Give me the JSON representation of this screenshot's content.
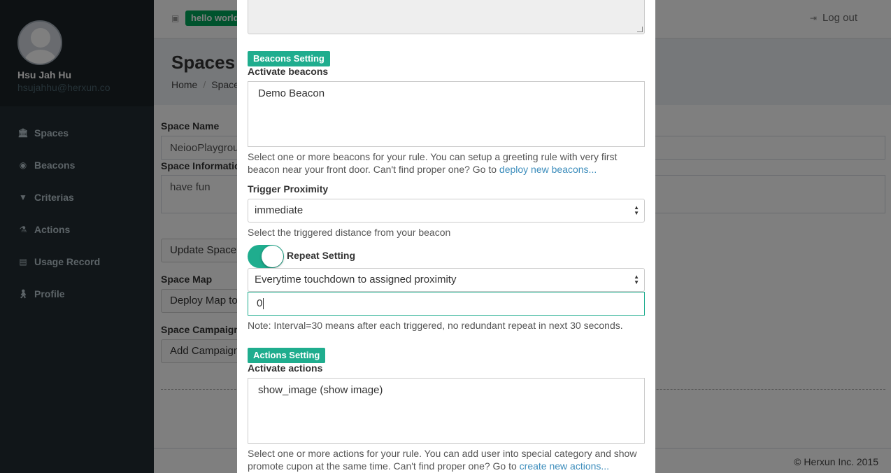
{
  "sidebar": {
    "user_name": "Hsu Jah Hu",
    "user_email": "hsujahhu@herxun.co",
    "items": [
      {
        "label": "Spaces",
        "icon": "bank-icon"
      },
      {
        "label": "Beacons",
        "icon": "dot-circle-icon"
      },
      {
        "label": "Criterias",
        "icon": "filter-icon"
      },
      {
        "label": "Actions",
        "icon": "flask-icon"
      },
      {
        "label": "Usage Record",
        "icon": "table-icon"
      },
      {
        "label": "Profile",
        "icon": "person-icon"
      }
    ]
  },
  "header": {
    "badge": "hello world",
    "logout_label": "Log out"
  },
  "content_header": {
    "title": "Spaces -",
    "breadcrumb_home": "Home",
    "breadcrumb_current": "Space"
  },
  "main": {
    "space_name_label": "Space Name",
    "space_name_value": "NeiooPlaygrou",
    "space_info_label": "Space Informatio",
    "space_info_value": "have fun",
    "update_button": "Update Space",
    "space_map_label": "Space Map",
    "deploy_map_button": "Deploy Map to",
    "space_campaigns_label": "Space Campaigns",
    "add_campaign_button": "Add Campaign"
  },
  "footer": {
    "copyright": "© Herxun Inc. 2015"
  },
  "modal": {
    "beacons_tag": "Beacons Setting",
    "activate_beacons_label": "Activate beacons",
    "beacons_selected": "Demo Beacon",
    "beacons_help": "Select one or more beacons for your rule. You can setup a greeting rule with very first beacon near your front door. Can't find proper one? Go to ",
    "beacons_help_link": "deploy new beacons...",
    "trigger_label": "Trigger Proximity",
    "trigger_value": "immediate",
    "trigger_help": "Select the triggered distance from your beacon",
    "repeat_label": "Repeat Setting",
    "repeat_toggle_on": true,
    "repeat_value": "Everytime touchdown to assigned proximity",
    "interval_value": "0",
    "interval_note": "Note: Interval=30 means after each triggered, no redundant repeat in next 30 seconds.",
    "actions_tag": "Actions Setting",
    "activate_actions_label": "Activate actions",
    "actions_selected": "show_image (show image)",
    "actions_help": "Select one or more actions for your rule. You can add user into special category and show promote cupon at the same time. Can't find proper one? Go to ",
    "actions_help_link": "create new actions..."
  },
  "colors": {
    "sidebar_bg": "#222d32",
    "accent_teal": "#1fad8e",
    "badge_green": "#00a65a",
    "link": "#3c8dbc"
  }
}
